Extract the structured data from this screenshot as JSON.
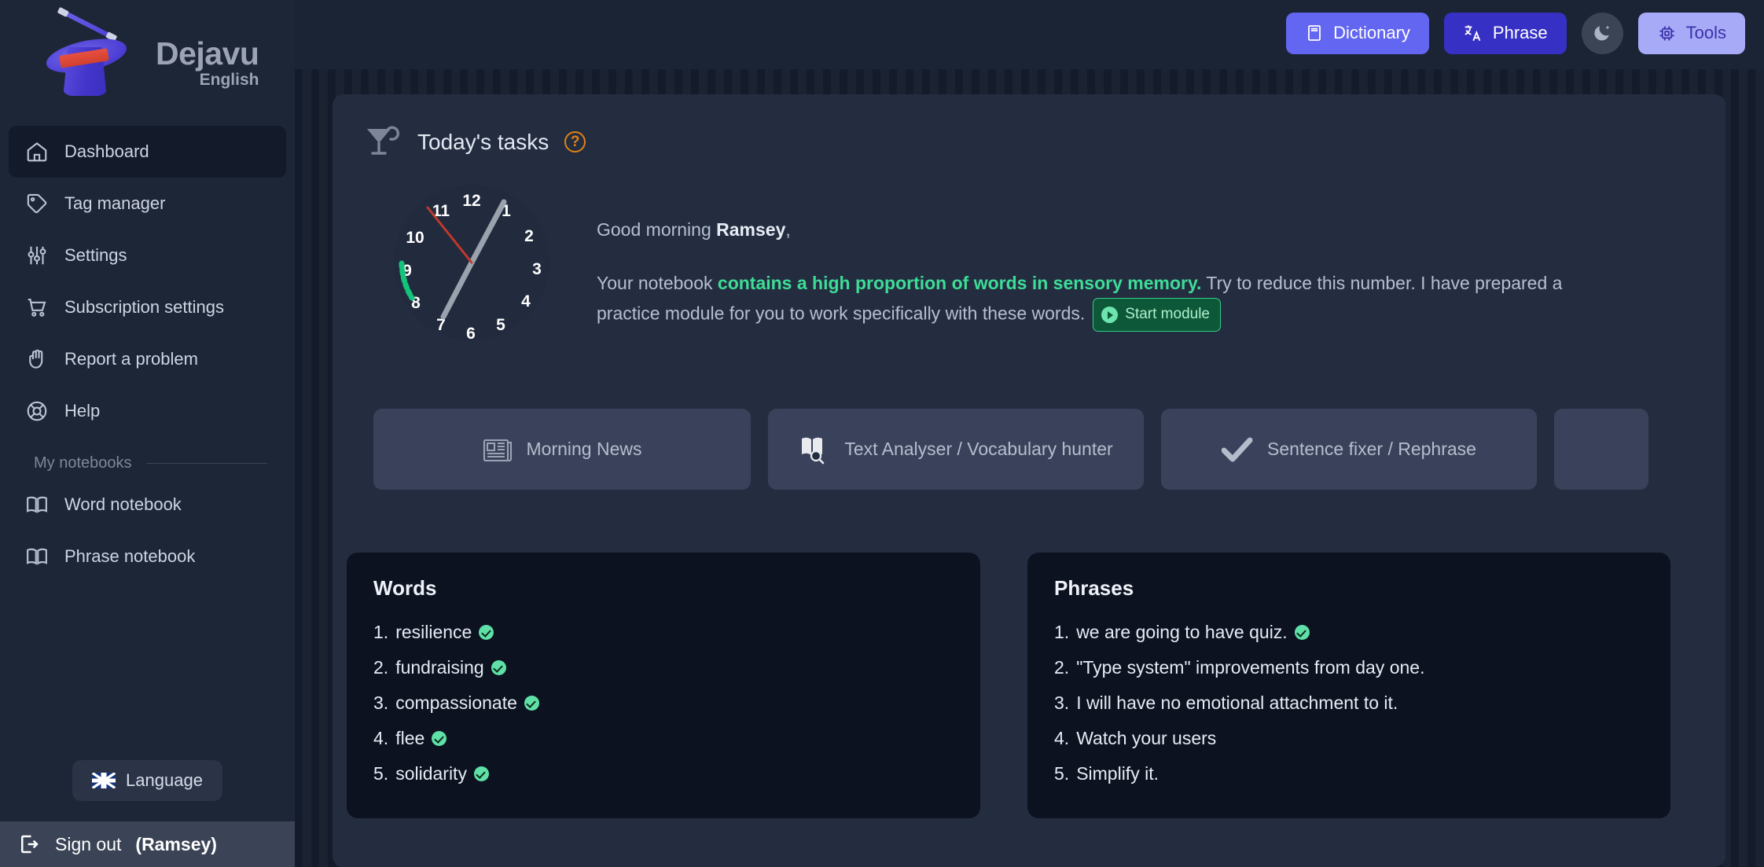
{
  "brand": {
    "name": "Dejavu",
    "subtitle": "English"
  },
  "topbar": {
    "dictionary": "Dictionary",
    "phrase": "Phrase",
    "tools": "Tools",
    "theme_toggle": "moon-icon"
  },
  "sidebar": {
    "items": [
      {
        "label": "Dashboard",
        "icon": "home-icon",
        "active": true
      },
      {
        "label": "Tag manager",
        "icon": "tag-icon",
        "active": false
      },
      {
        "label": "Settings",
        "icon": "sliders-icon",
        "active": false
      },
      {
        "label": "Subscription settings",
        "icon": "cart-icon",
        "active": false
      },
      {
        "label": "Report a problem",
        "icon": "hand-icon",
        "active": false
      },
      {
        "label": "Help",
        "icon": "lifebuoy-icon",
        "active": false
      }
    ],
    "notebooks_header": "My notebooks",
    "notebooks": [
      {
        "label": "Word notebook",
        "icon": "book-icon"
      },
      {
        "label": "Phrase notebook",
        "icon": "book-icon"
      }
    ],
    "language_button": "Language",
    "signout_label": "Sign out",
    "signout_user": "(Ramsey)"
  },
  "main": {
    "title": "Today's tasks",
    "help": "?",
    "greeting_prefix": "Good morning ",
    "greeting_name": "Ramsey",
    "greeting_suffix": ",",
    "notebook_line_1": "Your notebook ",
    "notebook_highlight": "contains a high proportion of words in sensory memory.",
    "notebook_line_2": " Try to reduce this number. I have prepared a practice module for you to work specifically with these words.",
    "start_module": "Start module",
    "clock": {
      "numbers": [
        "12",
        "1",
        "2",
        "3",
        "4",
        "5",
        "6",
        "7",
        "8",
        "9",
        "10",
        "11"
      ],
      "hour_hand_target": "1",
      "minute_hand_target": "10:30",
      "progress_arc_color": "#14c37a"
    },
    "modules": [
      {
        "label": "Morning News",
        "icon": "newspaper-icon"
      },
      {
        "label": "Text Analyser / Vocabulary hunter",
        "icon": "book-search-icon"
      },
      {
        "label": "Sentence fixer / Rephrase",
        "icon": "check-icon"
      },
      {
        "label": "",
        "icon": ""
      }
    ],
    "words_panel": {
      "title": "Words",
      "items": [
        {
          "n": "1.",
          "text": "resilience",
          "done": true
        },
        {
          "n": "2.",
          "text": "fundraising",
          "done": true
        },
        {
          "n": "3.",
          "text": "compassionate",
          "done": true
        },
        {
          "n": "4.",
          "text": "flee",
          "done": true
        },
        {
          "n": "5.",
          "text": "solidarity",
          "done": true
        }
      ]
    },
    "phrases_panel": {
      "title": "Phrases",
      "items": [
        {
          "n": "1.",
          "text": "we are going to have quiz.",
          "done": true
        },
        {
          "n": "2.",
          "text": "\"Type system\" improvements from day one.",
          "done": false
        },
        {
          "n": "3.",
          "text": "I will have no emotional attachment to it.",
          "done": false
        },
        {
          "n": "4.",
          "text": "Watch your users",
          "done": false
        },
        {
          "n": "5.",
          "text": "Simplify it.",
          "done": false
        }
      ]
    }
  },
  "colors": {
    "sidebar_bg": "#1d2637",
    "card_bg": "#242d40",
    "panel_bg": "#0c1220",
    "accent_green": "#3ddc97",
    "accent_indigo": "#6366f1",
    "accent_orange": "#e08214"
  }
}
